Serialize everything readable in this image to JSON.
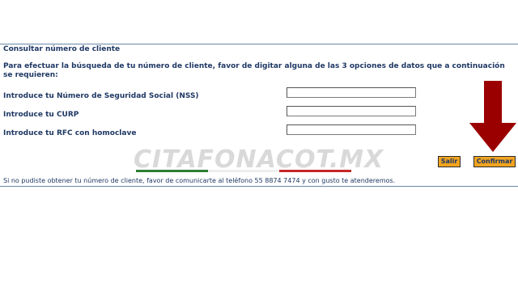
{
  "form": {
    "title": "Consultar número de cliente",
    "instructions": "Para efectuar la búsqueda de tu número de cliente, favor de digitar alguna de las 3 opciones de datos que a continuación se requieren:",
    "fields": [
      {
        "label": "Introduce tu Número de Seguridad Social (NSS)",
        "value": ""
      },
      {
        "label": "Introduce tu CURP",
        "value": ""
      },
      {
        "label": "Introduce tu RFC con homoclave",
        "value": ""
      }
    ],
    "buttons": {
      "exit": "Salir",
      "confirm": "Confirmar"
    },
    "footer": "Si no pudiste obtener tu número de cliente, favor de comunicarte al teléfono 55 8874 7474 y con gusto te atenderemos."
  },
  "watermark": {
    "text": "CITAFONACOT.MX",
    "colors": [
      "#2e7d32",
      "#ffffff",
      "#c62828"
    ]
  },
  "annotation": {
    "icon": "down-arrow-icon",
    "color": "#9b0000"
  },
  "colors": {
    "text": "#1f3864",
    "button": "#f2a41f",
    "rule": "#6b86a8"
  }
}
